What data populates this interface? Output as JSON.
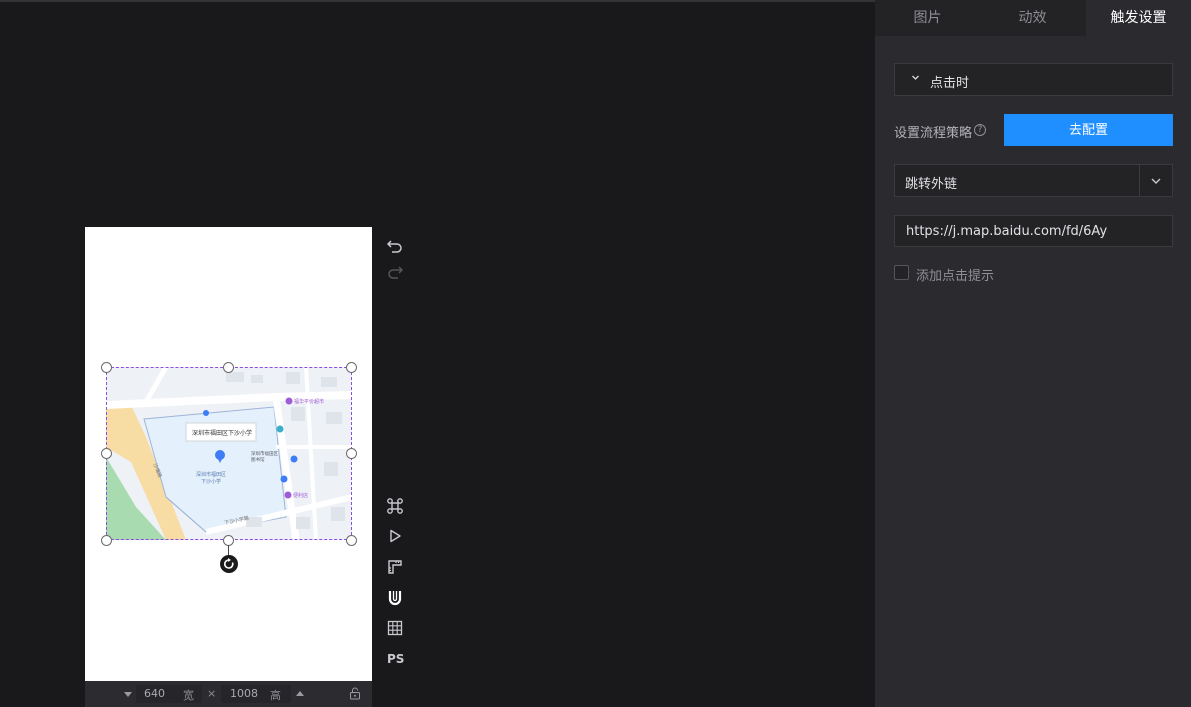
{
  "tabs": [
    {
      "label": "图片"
    },
    {
      "label": "动效"
    },
    {
      "label": "触发设置"
    }
  ],
  "active_tab": "触发设置",
  "trigger": {
    "event_label": "点击时",
    "strategy_label": "设置流程策略",
    "help_icon": "?",
    "config_button": "去配置",
    "action_select_value": "跳转外链",
    "url_value": "https://j.map.baidu.com/fd/6Ay",
    "hint_checkbox_label": "添加点击提示",
    "hint_checked": false
  },
  "canvas": {
    "width_value": "640",
    "width_unit": "宽",
    "times": "×",
    "height_value": "1008",
    "height_unit": "高"
  },
  "toolbar": {
    "ps_label": "PS",
    "icons": [
      "undo-icon",
      "redo-icon",
      "command-icon",
      "play-icon",
      "ruler-icon",
      "magnet-icon",
      "grid-icon"
    ]
  },
  "map": {
    "place_label": "深圳市福田区下沙小学",
    "school_label": "深圳市福田区\n下沙小学",
    "road_label": "沙嘴路",
    "road_label_2": "下沙小学路",
    "poi_1": "福华平价超市",
    "poi_2": "便利店",
    "poi_3": "深圳市福田区\n图书馆"
  },
  "colors": {
    "accent": "#1f8fff",
    "panel_bg": "#2b2b2f",
    "canvas_bg": "#19191b",
    "selection": "#8a4de0"
  }
}
